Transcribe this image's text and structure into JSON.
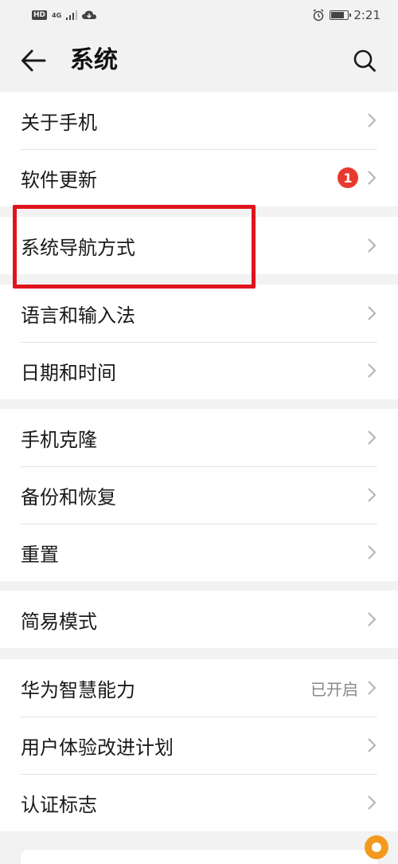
{
  "status_bar": {
    "left_badge": "HD",
    "network": "4G",
    "time": "2:21",
    "icons": [
      "signal-icon",
      "cloud-icon",
      "alarm-icon",
      "battery-icon"
    ]
  },
  "app_bar": {
    "title": "系统",
    "icons": [
      "back-arrow-icon",
      "search-icon"
    ]
  },
  "groups": [
    {
      "items": [
        {
          "label": "关于手机"
        },
        {
          "label": "软件更新",
          "badge": "1"
        }
      ]
    },
    {
      "items": [
        {
          "label": "系统导航方式"
        }
      ]
    },
    {
      "items": [
        {
          "label": "语言和输入法"
        },
        {
          "label": "日期和时间"
        }
      ]
    },
    {
      "items": [
        {
          "label": "手机克隆"
        },
        {
          "label": "备份和恢复"
        },
        {
          "label": "重置"
        }
      ]
    },
    {
      "items": [
        {
          "label": "简易模式"
        }
      ]
    },
    {
      "items": [
        {
          "label": "华为智慧能力",
          "status": "已开启"
        },
        {
          "label": "用户体验改进计划"
        },
        {
          "label": "认证标志"
        }
      ]
    }
  ],
  "colors": {
    "accent_highlight": "#e0141c",
    "badge": "#e8392f",
    "background": "#f2f2f2",
    "card": "#ffffff"
  },
  "battery_level": 0.85
}
